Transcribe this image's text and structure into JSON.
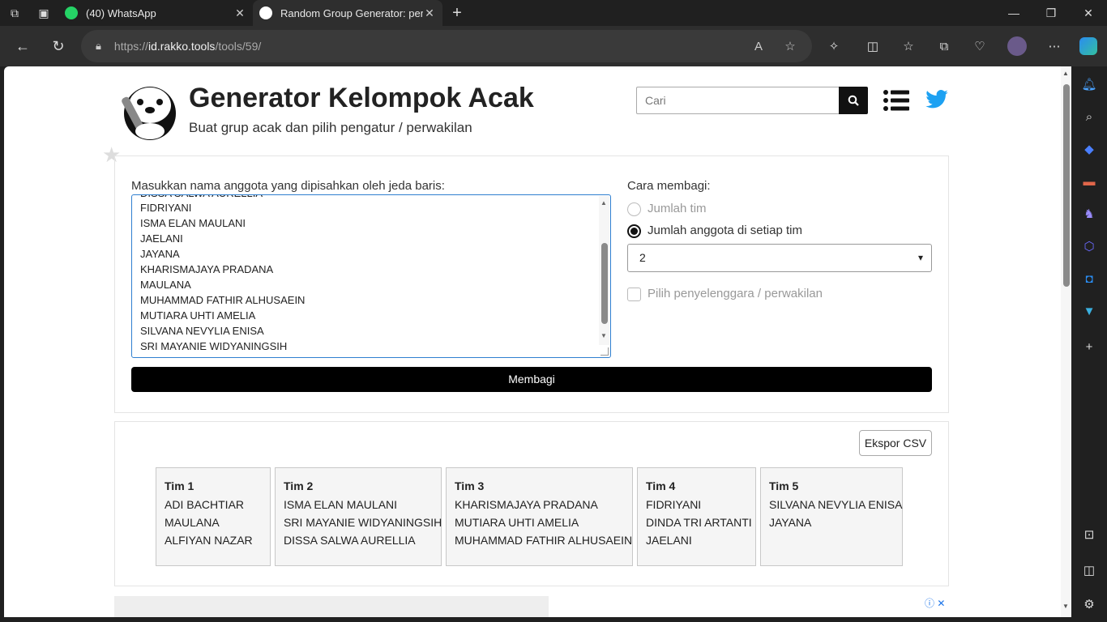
{
  "browser": {
    "tabs": [
      {
        "title": "(40) WhatsApp",
        "favicon_color": "#25D366",
        "badge": "40",
        "active": false
      },
      {
        "title": "Random Group Generator: pemb",
        "favicon_color": "#ffffff",
        "active": true
      }
    ],
    "new_tab_label": "+",
    "url_prefix": "https://",
    "url_domain": "id.rakko.tools",
    "url_path": "/tools/59/"
  },
  "header": {
    "title": "Generator Kelompok Acak",
    "subtitle": "Buat grup acak dan pilih pengatur / perwakilan",
    "search_placeholder": "Cari"
  },
  "form": {
    "input_label": "Masukkan nama anggota yang dipisahkan oleh jeda baris:",
    "members": [
      "DISSA SALWA AURELLIA",
      "FIDRIYANI",
      "ISMA ELAN MAULANI",
      "JAELANI",
      "JAYANA",
      "KHARISMAJAYA PRADANA",
      "MAULANA",
      "MUHAMMAD FATHIR ALHUSAEIN",
      "MUTIARA UHTI AMELIA",
      "SILVANA NEVYLIA ENISA",
      "SRI MAYANIE WIDYANINGSIH"
    ],
    "divide_label": "Cara membagi:",
    "option_teams": "Jumlah tim",
    "option_members_per_team": "Jumlah anggota di setiap tim",
    "selected_value": "2",
    "organizer_label": "Pilih penyelenggara / perwakilan",
    "submit_label": "Membagi"
  },
  "results": {
    "export_label": "Ekspor CSV",
    "teams": [
      {
        "name": "Tim 1",
        "members": [
          "ADI BACHTIAR",
          "MAULANA",
          "ALFIYAN NAZAR"
        ]
      },
      {
        "name": "Tim 2",
        "members": [
          "ISMA ELAN MAULANI",
          "SRI MAYANIE WIDYANINGSIH",
          "DISSA SALWA AURELLIA"
        ]
      },
      {
        "name": "Tim 3",
        "members": [
          "KHARISMAJAYA PRADANA",
          "MUTIARA UHTI AMELIA",
          "MUHAMMAD FATHIR ALHUSAEIN"
        ]
      },
      {
        "name": "Tim 4",
        "members": [
          "FIDRIYANI",
          "DINDA TRI ARTANTI",
          "JAELANI"
        ]
      },
      {
        "name": "Tim 5",
        "members": [
          "SILVANA NEVYLIA ENISA",
          "JAYANA"
        ]
      }
    ]
  },
  "ad": {
    "close_label": "ⓘ ✕"
  },
  "colors": {
    "accent": "#000000",
    "twitter": "#1DA1F2",
    "focus": "#2f7fd0"
  }
}
